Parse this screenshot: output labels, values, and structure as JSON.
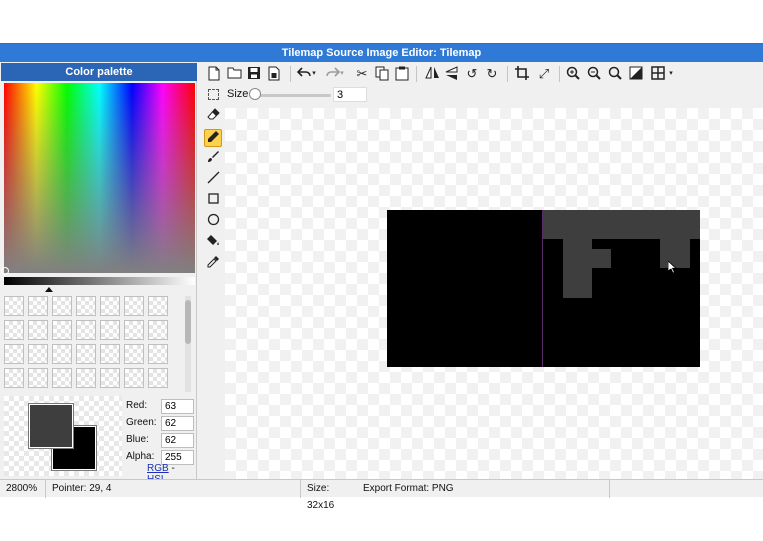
{
  "window": {
    "title": "Tilemap Source Image Editor: Tilemap"
  },
  "palette": {
    "title": "Color palette",
    "red_label": "Red:",
    "red": "63",
    "green_label": "Green:",
    "green": "62",
    "blue_label": "Blue:",
    "blue": "62",
    "alpha_label": "Alpha:",
    "alpha": "255",
    "rgb_link": "RGB",
    "separator": "-",
    "hsl_link": "HSL",
    "primary_color": "#3f3e3e",
    "secondary_color": "#000000"
  },
  "toolbar": {
    "icons": [
      "new-file-icon",
      "open-folder-icon",
      "save-icon",
      "save-as-icon",
      "undo-icon",
      "redo-icon",
      "cut-icon",
      "copy-icon",
      "paste-icon",
      "flip-horizontal-icon",
      "flip-vertical-icon",
      "rotate-left-icon",
      "rotate-right-icon",
      "crop-icon",
      "resize-icon",
      "zoom-in-icon",
      "zoom-out-icon",
      "zoom-reset-icon",
      "contrast-icon",
      "grid-icon"
    ],
    "size_label": "Size",
    "size_value": "3"
  },
  "tools": [
    "eraser-icon",
    "pencil-icon",
    "brush-icon",
    "line-icon",
    "rectangle-icon",
    "ellipse-icon",
    "fill-bucket-icon",
    "eyedropper-icon"
  ],
  "active_tool": "pencil-icon",
  "status": {
    "zoom": "2800%",
    "pointer": "Pointer: 29, 4",
    "size": "Size: 32x16",
    "export_format": "Export Format: PNG"
  }
}
